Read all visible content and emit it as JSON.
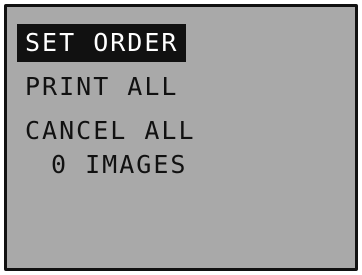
{
  "menu": {
    "items": [
      {
        "label": "SET ORDER",
        "selected": true
      },
      {
        "label": "PRINT ALL",
        "selected": false
      },
      {
        "label": "CANCEL ALL",
        "selected": false
      }
    ]
  },
  "status": {
    "count": "0",
    "unit": "IMAGES"
  },
  "colors": {
    "screen_bg": "#a9a9a9",
    "text": "#111111",
    "highlight_bg": "#111111",
    "highlight_text": "#ffffff"
  }
}
